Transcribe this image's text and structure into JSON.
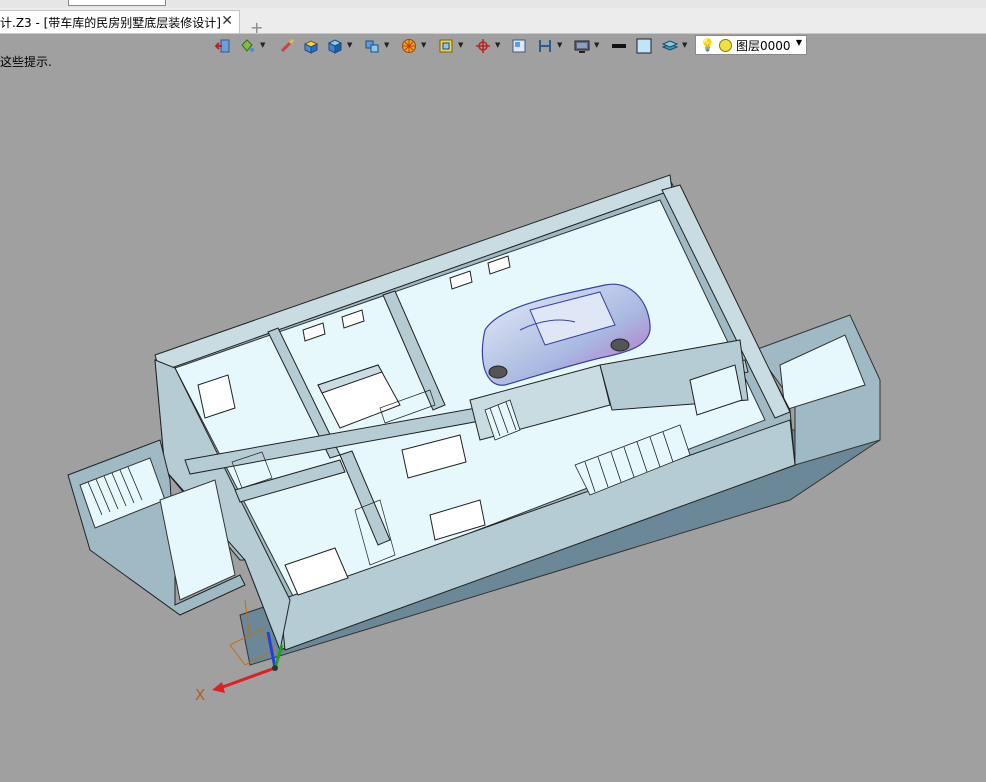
{
  "top_strip": {
    "combo_value": ""
  },
  "tabs": [
    {
      "title": "计.Z3 - [带车库的民房别墅底层装修设计]",
      "active": true
    }
  ],
  "tab_close_glyph": "✕",
  "new_tab_glyph": "+",
  "toolbar": {
    "icons": [
      "exit-icon",
      "paint-bucket-icon",
      "brush-icon",
      "cube-edit-icon",
      "cube-icon",
      "view-cube-icon",
      "palette-icon",
      "frame-icon",
      "axis-icon",
      "plane-view-icon",
      "section-icon",
      "display-icon",
      "line-weight-icon",
      "color-swatch-icon",
      "layer-stack-icon"
    ],
    "layer": {
      "name": "图层0000",
      "color": "#f0e040"
    }
  },
  "hint_text": "这些提示.",
  "viewport": {
    "background": "#a0a0a0",
    "axis_label": "X",
    "model": "带车库的民房别墅底层装修设计"
  }
}
